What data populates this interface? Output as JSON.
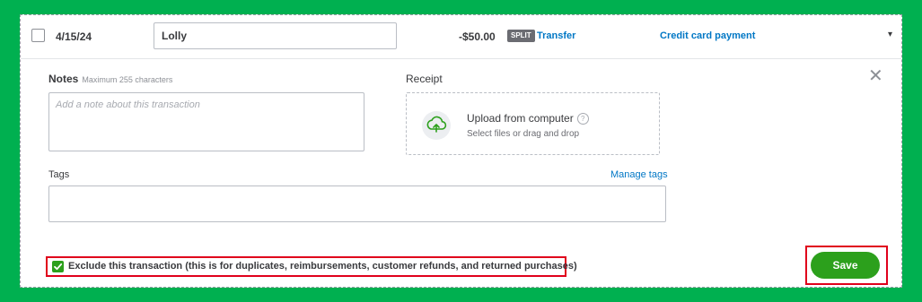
{
  "transaction": {
    "date": "4/15/24",
    "payee": "Lolly",
    "amount": "-$50.00",
    "split_badge": "SPLIT",
    "type": "Transfer",
    "category": "Credit card payment"
  },
  "notes": {
    "label": "Notes",
    "hint": "Maximum 255 characters",
    "placeholder": "Add a note about this transaction"
  },
  "receipt": {
    "label": "Receipt",
    "upload_title": "Upload from computer",
    "upload_subtitle": "Select files or drag and drop"
  },
  "tags": {
    "label": "Tags",
    "manage_link": "Manage tags"
  },
  "exclude": {
    "checked": true,
    "label": "Exclude this transaction (this is for duplicates, reimbursements, customer refunds, and returned purchases)"
  },
  "actions": {
    "save_label": "Save"
  },
  "colors": {
    "accent_green": "#2ca01c",
    "link_blue": "#0077c5",
    "highlight_red": "#e0001b",
    "background_green": "#00b050"
  },
  "icons": [
    "checkbox-icon",
    "chevron-down-icon",
    "close-icon",
    "cloud-upload-icon",
    "help-icon",
    "checkmark-icon"
  ]
}
